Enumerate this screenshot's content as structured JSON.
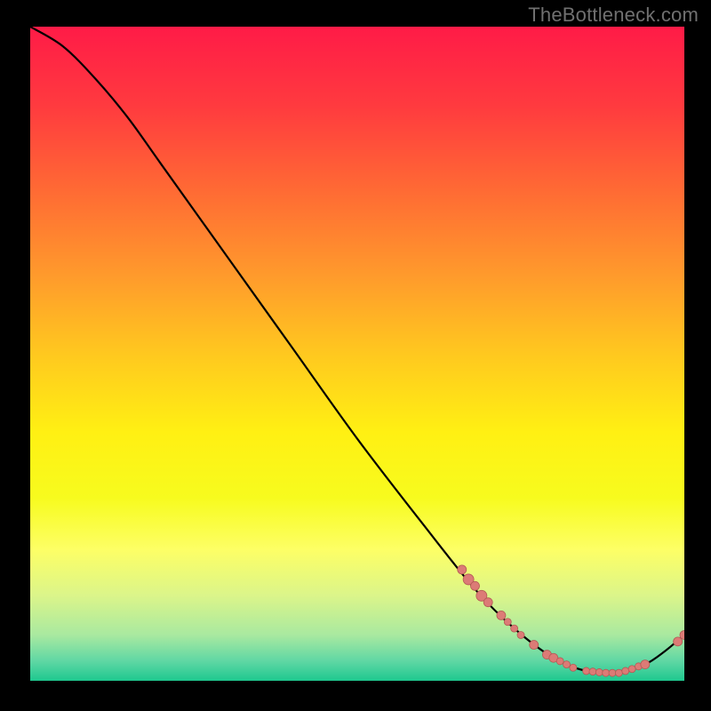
{
  "watermark": "TheBottleneck.com",
  "colors": {
    "marker_fill": "#dc7b76",
    "marker_stroke": "#b45a55",
    "curve": "#000000"
  },
  "gradient_stops": [
    {
      "offset": 0.0,
      "color": "#ff1b47"
    },
    {
      "offset": 0.12,
      "color": "#ff3a3f"
    },
    {
      "offset": 0.25,
      "color": "#ff6a34"
    },
    {
      "offset": 0.38,
      "color": "#ff9a2c"
    },
    {
      "offset": 0.5,
      "color": "#ffc81f"
    },
    {
      "offset": 0.62,
      "color": "#fff013"
    },
    {
      "offset": 0.72,
      "color": "#f7fb1e"
    },
    {
      "offset": 0.8,
      "color": "#fdff66"
    },
    {
      "offset": 0.87,
      "color": "#dbf58a"
    },
    {
      "offset": 0.93,
      "color": "#a9e9a0"
    },
    {
      "offset": 0.97,
      "color": "#5fd7a4"
    },
    {
      "offset": 1.0,
      "color": "#1ec88f"
    }
  ],
  "chart_data": {
    "type": "line",
    "title": "",
    "xlabel": "",
    "ylabel": "",
    "xlim": [
      0,
      100
    ],
    "ylim": [
      0,
      100
    ],
    "curve": [
      {
        "x": 0,
        "y": 100
      },
      {
        "x": 5,
        "y": 97
      },
      {
        "x": 10,
        "y": 92
      },
      {
        "x": 15,
        "y": 86
      },
      {
        "x": 20,
        "y": 79
      },
      {
        "x": 30,
        "y": 65
      },
      {
        "x": 40,
        "y": 51
      },
      {
        "x": 50,
        "y": 37
      },
      {
        "x": 60,
        "y": 24
      },
      {
        "x": 68,
        "y": 14
      },
      {
        "x": 74,
        "y": 8
      },
      {
        "x": 80,
        "y": 3.5
      },
      {
        "x": 85,
        "y": 1.5
      },
      {
        "x": 90,
        "y": 1.2
      },
      {
        "x": 94,
        "y": 2.5
      },
      {
        "x": 97,
        "y": 4.5
      },
      {
        "x": 100,
        "y": 7
      }
    ],
    "markers": [
      {
        "x": 66,
        "y": 17.0,
        "r": 5
      },
      {
        "x": 67,
        "y": 15.5,
        "r": 6
      },
      {
        "x": 68,
        "y": 14.5,
        "r": 5
      },
      {
        "x": 69,
        "y": 13.0,
        "r": 6
      },
      {
        "x": 70,
        "y": 12.0,
        "r": 5
      },
      {
        "x": 72,
        "y": 10.0,
        "r": 5
      },
      {
        "x": 73,
        "y": 9.0,
        "r": 4
      },
      {
        "x": 74,
        "y": 8.0,
        "r": 4
      },
      {
        "x": 75,
        "y": 7.0,
        "r": 4
      },
      {
        "x": 77,
        "y": 5.5,
        "r": 5
      },
      {
        "x": 79,
        "y": 4.0,
        "r": 5
      },
      {
        "x": 80,
        "y": 3.5,
        "r": 5
      },
      {
        "x": 81,
        "y": 3.0,
        "r": 4
      },
      {
        "x": 82,
        "y": 2.5,
        "r": 4
      },
      {
        "x": 83,
        "y": 2.0,
        "r": 4
      },
      {
        "x": 85,
        "y": 1.5,
        "r": 4
      },
      {
        "x": 86,
        "y": 1.4,
        "r": 4
      },
      {
        "x": 87,
        "y": 1.3,
        "r": 4
      },
      {
        "x": 88,
        "y": 1.2,
        "r": 4
      },
      {
        "x": 89,
        "y": 1.2,
        "r": 4
      },
      {
        "x": 90,
        "y": 1.2,
        "r": 4
      },
      {
        "x": 91,
        "y": 1.5,
        "r": 4
      },
      {
        "x": 92,
        "y": 1.8,
        "r": 4
      },
      {
        "x": 93,
        "y": 2.2,
        "r": 4
      },
      {
        "x": 94,
        "y": 2.5,
        "r": 5
      },
      {
        "x": 99,
        "y": 6.0,
        "r": 5
      },
      {
        "x": 100,
        "y": 7.0,
        "r": 5
      }
    ]
  }
}
